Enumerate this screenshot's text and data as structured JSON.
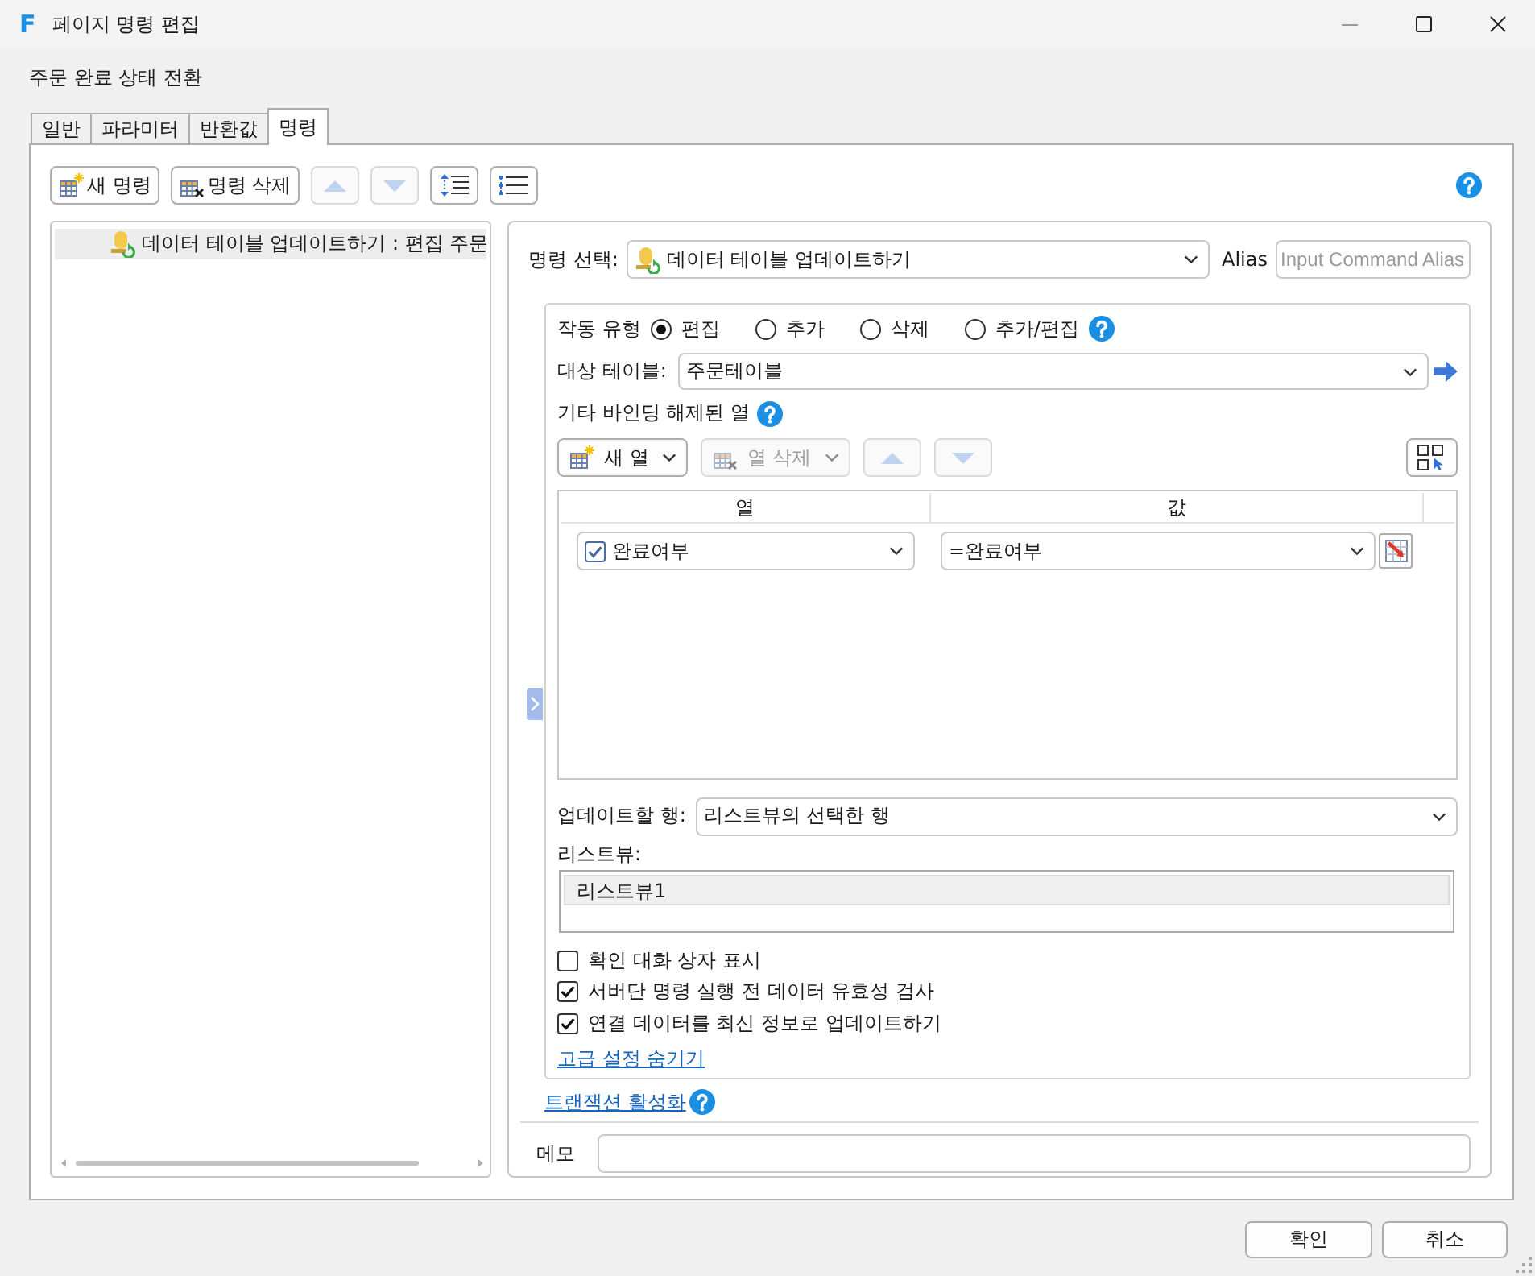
{
  "window": {
    "logo": "F",
    "title": "페이지 명령 편집"
  },
  "subtitle": "주문 완료 상태 전환",
  "tabs": [
    {
      "label": "일반",
      "selected": false
    },
    {
      "label": "파라미터",
      "selected": false
    },
    {
      "label": "반환값",
      "selected": false
    },
    {
      "label": "명령",
      "selected": true
    }
  ],
  "toolbar": [
    {
      "kind": "new",
      "label": "새 명령",
      "disabled": false
    },
    {
      "kind": "delete",
      "label": "명령 삭제",
      "disabled": false
    },
    {
      "kind": "up",
      "disabled": true
    },
    {
      "kind": "down",
      "disabled": true
    },
    {
      "kind": "indent",
      "disabled": false
    },
    {
      "kind": "list",
      "disabled": false
    }
  ],
  "command_tree": [
    {
      "label": "데이터 테이블 업데이트하기 : 편집 주문",
      "selected": true
    }
  ],
  "command_select": {
    "label": "명령 선택:",
    "value": "데이터 테이블 업데이트하기"
  },
  "alias": {
    "label": "Alias",
    "placeholder": "Input Command Alias"
  },
  "action_type": {
    "label": "작동 유형",
    "options": [
      {
        "label": "편집",
        "selected": true
      },
      {
        "label": "추가",
        "selected": false
      },
      {
        "label": "삭제",
        "selected": false
      },
      {
        "label": "추가/편집",
        "selected": false
      }
    ]
  },
  "target_table": {
    "label": "대상 테이블:",
    "value": "주문테이블"
  },
  "unbound_columns": {
    "label": "기타 바인딩 해제된 열",
    "toolbar": [
      {
        "kind": "new",
        "label": "새 열",
        "disabled": false
      },
      {
        "kind": "delete",
        "label": "열 삭제",
        "disabled": true
      },
      {
        "kind": "up",
        "disabled": true
      },
      {
        "kind": "down",
        "disabled": true
      }
    ],
    "columns": [
      "열",
      "값"
    ],
    "rows": [
      {
        "checked": true,
        "column": "완료여부",
        "value": "=완료여부"
      }
    ]
  },
  "rows_to_update": {
    "label": "업데이트할 행:",
    "value": "리스트뷰의 선택한 행"
  },
  "listview": {
    "label": "리스트뷰:",
    "items": [
      {
        "label": "리스트뷰1",
        "selected": true
      }
    ]
  },
  "options": [
    {
      "label": "확인 대화 상자 표시",
      "checked": false
    },
    {
      "label": "서버단 명령 실행 전 데이터 유효성 검사",
      "checked": true
    },
    {
      "label": "연결 데이터를 최신 정보로 업데이트하기",
      "checked": true
    }
  ],
  "advanced_link": "고급 설정 숨기기",
  "transaction_link": "트랜잭션 활성화",
  "memo": {
    "label": "메모"
  },
  "buttons": [
    "확인",
    "취소"
  ]
}
